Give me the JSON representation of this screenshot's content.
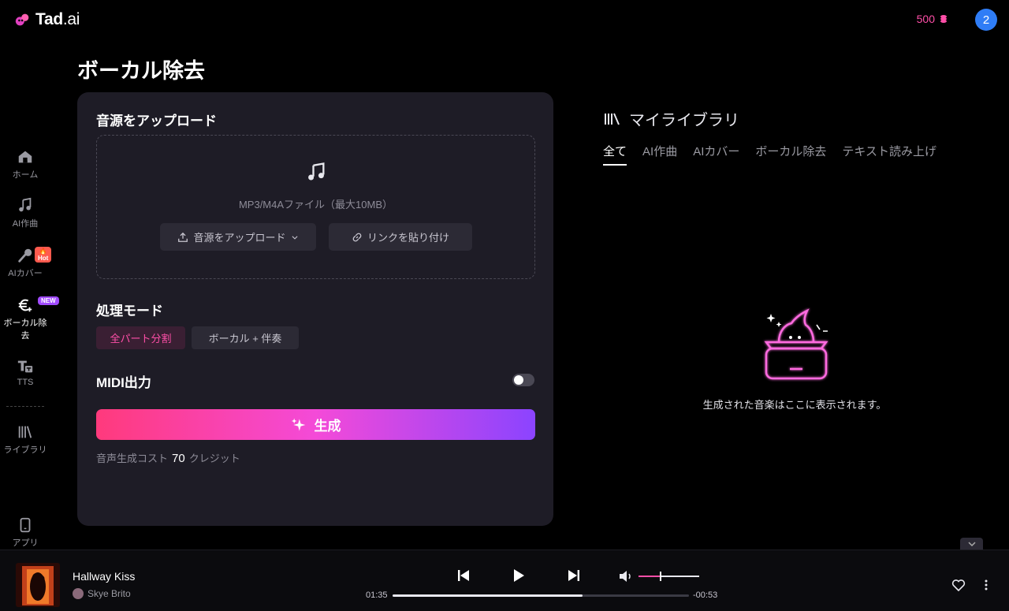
{
  "logo": {
    "brand": "Tad",
    "suffix": ".ai"
  },
  "header": {
    "credits": "500",
    "avatar_letter": "2"
  },
  "sidebar": {
    "items": [
      {
        "label": "ホーム",
        "icon": "home-icon"
      },
      {
        "label": "AI作曲",
        "icon": "music-note-icon"
      },
      {
        "label": "AIカバー",
        "icon": "microphone-icon",
        "badge": "🔥Hot"
      },
      {
        "label": "ボーカル除去",
        "icon": "vocal-remove-icon",
        "badge": "NEW"
      },
      {
        "label": "TTS",
        "icon": "tts-icon"
      },
      {
        "label": "ライブラリ",
        "icon": "library-icon"
      },
      {
        "label": "アプリ",
        "icon": "phone-icon"
      }
    ]
  },
  "page": {
    "title": "ボーカル除去"
  },
  "upload": {
    "title": "音源をアップロード",
    "hint": "MP3/M4Aファイル（最大10MB）",
    "upload_button": "音源をアップロード",
    "link_button": "リンクを貼り付け"
  },
  "mode": {
    "title": "処理モード",
    "options": [
      "全パート分割",
      "ボーカル + 伴奏"
    ],
    "selected": "全パート分割"
  },
  "midi": {
    "label": "MIDI出力",
    "enabled": false
  },
  "generate": {
    "label": "生成"
  },
  "cost": {
    "prefix": "音声生成コスト",
    "amount": "70",
    "suffix": "クレジット"
  },
  "library": {
    "title": "マイライブラリ",
    "tabs": [
      "全て",
      "AI作曲",
      "AIカバー",
      "ボーカル除去",
      "テキスト読み上げ"
    ],
    "active_tab": "全て",
    "empty_text": "生成された音楽はここに表示されます。"
  },
  "player": {
    "track_title": "Hallway Kiss",
    "artist": "Skye Brito",
    "elapsed": "01:35",
    "remaining": "-00:53",
    "progress": 0.64,
    "volume": 0.35
  },
  "colors": {
    "accent": "#ff4fa8",
    "panel": "#1e1c26",
    "avatar": "#2f7df6"
  }
}
